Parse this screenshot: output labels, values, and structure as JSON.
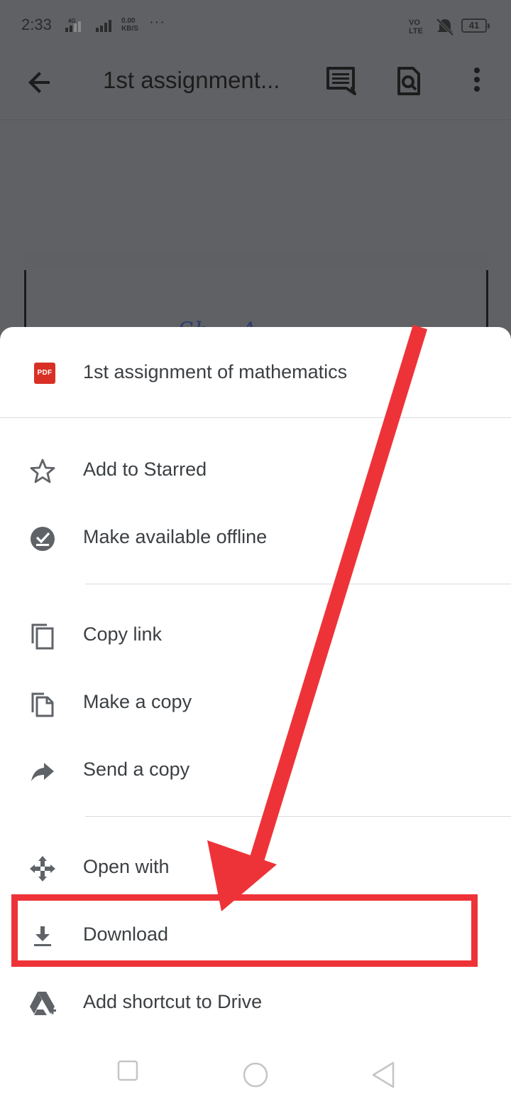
{
  "status_bar": {
    "time": "2:33",
    "network_type": "4G",
    "speed_value": "0.00",
    "speed_unit": "KB/S",
    "more_dots": "···",
    "volte_label": "VO LTE",
    "battery_level": "41"
  },
  "app_bar": {
    "title": "1st assignment...",
    "icons": [
      "arrow-back-icon",
      "comments-icon",
      "find-in-page-icon",
      "more-vert-icon"
    ]
  },
  "preview": {
    "script_text": "Sh... A..... ..."
  },
  "sheet": {
    "file_type_badge": "PDF",
    "file_name": "1st assignment of mathematics",
    "items": [
      {
        "label": "Add to Starred",
        "icon": "star-outline-icon"
      },
      {
        "label": "Make available offline",
        "icon": "offline-check-icon"
      },
      {
        "label": "Copy link",
        "icon": "copy-link-icon"
      },
      {
        "label": "Make a copy",
        "icon": "make-copy-icon"
      },
      {
        "label": "Send a copy",
        "icon": "share-arrow-icon"
      },
      {
        "label": "Open with",
        "icon": "open-with-icon"
      },
      {
        "label": "Download",
        "icon": "download-icon"
      },
      {
        "label": "Add shortcut to Drive",
        "icon": "drive-shortcut-icon"
      }
    ]
  },
  "annotation": {
    "highlight_color": "#ee3338",
    "arrow_color": "#ee3338"
  },
  "nav_bar": {
    "buttons": [
      "recents-square-icon",
      "home-circle-icon",
      "back-triangle-icon"
    ]
  }
}
